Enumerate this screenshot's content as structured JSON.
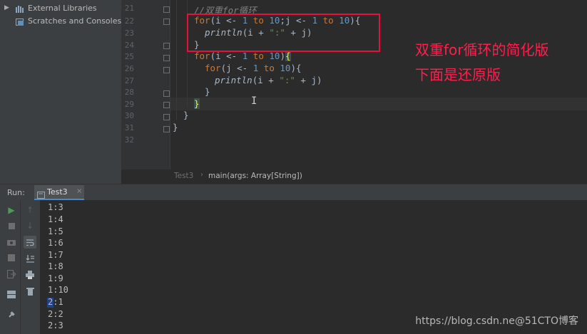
{
  "project_tree": {
    "items": [
      {
        "label": "External Libraries",
        "icon": "library-icon",
        "expanded": false
      },
      {
        "label": "Scratches and Consoles",
        "icon": "scratches-icon"
      }
    ]
  },
  "editor": {
    "line_numbers": [
      "21",
      "22",
      "23",
      "24",
      "25",
      "26",
      "27",
      "28",
      "29",
      "30",
      "31",
      "32"
    ],
    "lines": {
      "l21_comment": "//双重for循环",
      "l22_kw": "for",
      "l22_a": "(i <- ",
      "l22_n1": "1",
      "l22_b": " to ",
      "l22_n2": "10",
      "l22_c": ";j <- ",
      "l22_n3": "1",
      "l22_d": " to ",
      "l22_n4": "10",
      "l22_e": "){",
      "l23_fn": "println",
      "l23_a": "(i + ",
      "l23_str": "\":\"",
      "l23_b": " + j)",
      "l24": "}",
      "l25_kw": "for",
      "l25_a": "(i <- ",
      "l25_n1": "1",
      "l25_b": " to ",
      "l25_n2": "10",
      "l25_c": ")",
      "l25_brace": "{",
      "l26_kw": "for",
      "l26_a": "(j <- ",
      "l26_n1": "1",
      "l26_b": " to ",
      "l26_n2": "10",
      "l26_c": "){",
      "l27_fn": "println",
      "l27_a": "(i + ",
      "l27_str": "\":\"",
      "l27_b": " + j)",
      "l28": "}",
      "l29": "}",
      "l30": "}",
      "l31": "}"
    },
    "annotation_line1": "双重for循环的简化版",
    "annotation_line2": "下面是还原版",
    "breadcrumb": {
      "file": "Test3",
      "method": "main(args: Array[String])"
    }
  },
  "run_panel": {
    "label": "Run:",
    "tab": "Test3",
    "output": [
      "1:3",
      "1:4",
      "1:5",
      "1:6",
      "1:7",
      "1:8",
      "1:9",
      "1:10",
      "2:1",
      "2:2",
      "2:3"
    ]
  },
  "watermark": "https://blog.csdn.ne@51CTO博客",
  "colors": {
    "accent_red": "#ff1f4d",
    "keyword": "#cc7832",
    "number": "#6897bb",
    "string": "#6a8759",
    "run_green": "#499c54"
  }
}
